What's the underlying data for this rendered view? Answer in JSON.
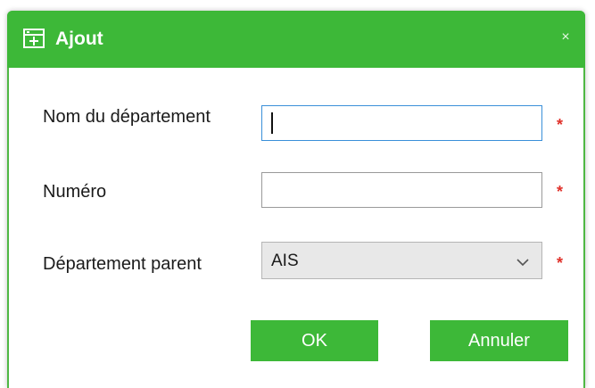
{
  "dialog": {
    "title": "Ajout",
    "title_icon": "add-department-icon",
    "close_glyph": "×",
    "accent_color": "#3db838"
  },
  "form": {
    "department_name": {
      "label": "Nom du département",
      "value": "",
      "required_mark": "*"
    },
    "number": {
      "label": "Numéro",
      "value": "",
      "required_mark": "*"
    },
    "parent_department": {
      "label": "Département parent",
      "selected": "AIS",
      "required_mark": "*"
    }
  },
  "buttons": {
    "ok": "OK",
    "cancel": "Annuler"
  }
}
